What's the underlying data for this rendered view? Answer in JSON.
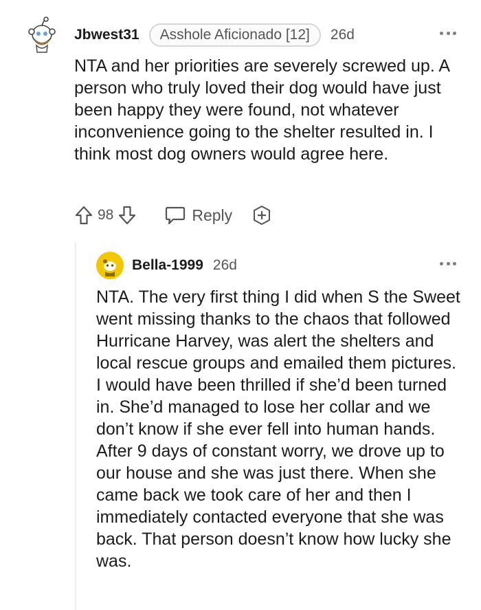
{
  "comment": {
    "username": "Jbwest31",
    "flair": "Asshole Aficionado [12]",
    "age": "26d",
    "body": "NTA and her priorities are severely screwed up. A person who truly loved their dog would have just been happy they were found, not whatever inconvenience going to the shelter resulted in. I think most dog owners would agree here.",
    "score": "98",
    "reply_label": "Reply"
  },
  "reply": {
    "username": "Bella-1999",
    "age": "26d",
    "body": "NTA. The very first thing I did when S the Sweet went missing thanks to the chaos that followed Hurricane Harvey, was alert the shelters and local rescue groups and emailed them pictures. I would have been thrilled if she’d been turned in. She’d managed to lose her collar and we don’t know if she ever fell into human hands. After 9 days of constant worry, we drove up to our house and she was just there. When she came back we took care of her and then I immediately contacted everyone that she was back. That person doesn’t know how lucky she was."
  },
  "colors": {
    "text": "#1c1c1c",
    "muted": "#555555",
    "avatar2_bg": "#f2c600"
  },
  "icons": [
    "snoo-avatar-icon",
    "upvote-icon",
    "downvote-icon",
    "reply-bubble-icon",
    "award-plus-icon",
    "more-options-icon",
    "snoo-avatar-yellow-icon"
  ]
}
